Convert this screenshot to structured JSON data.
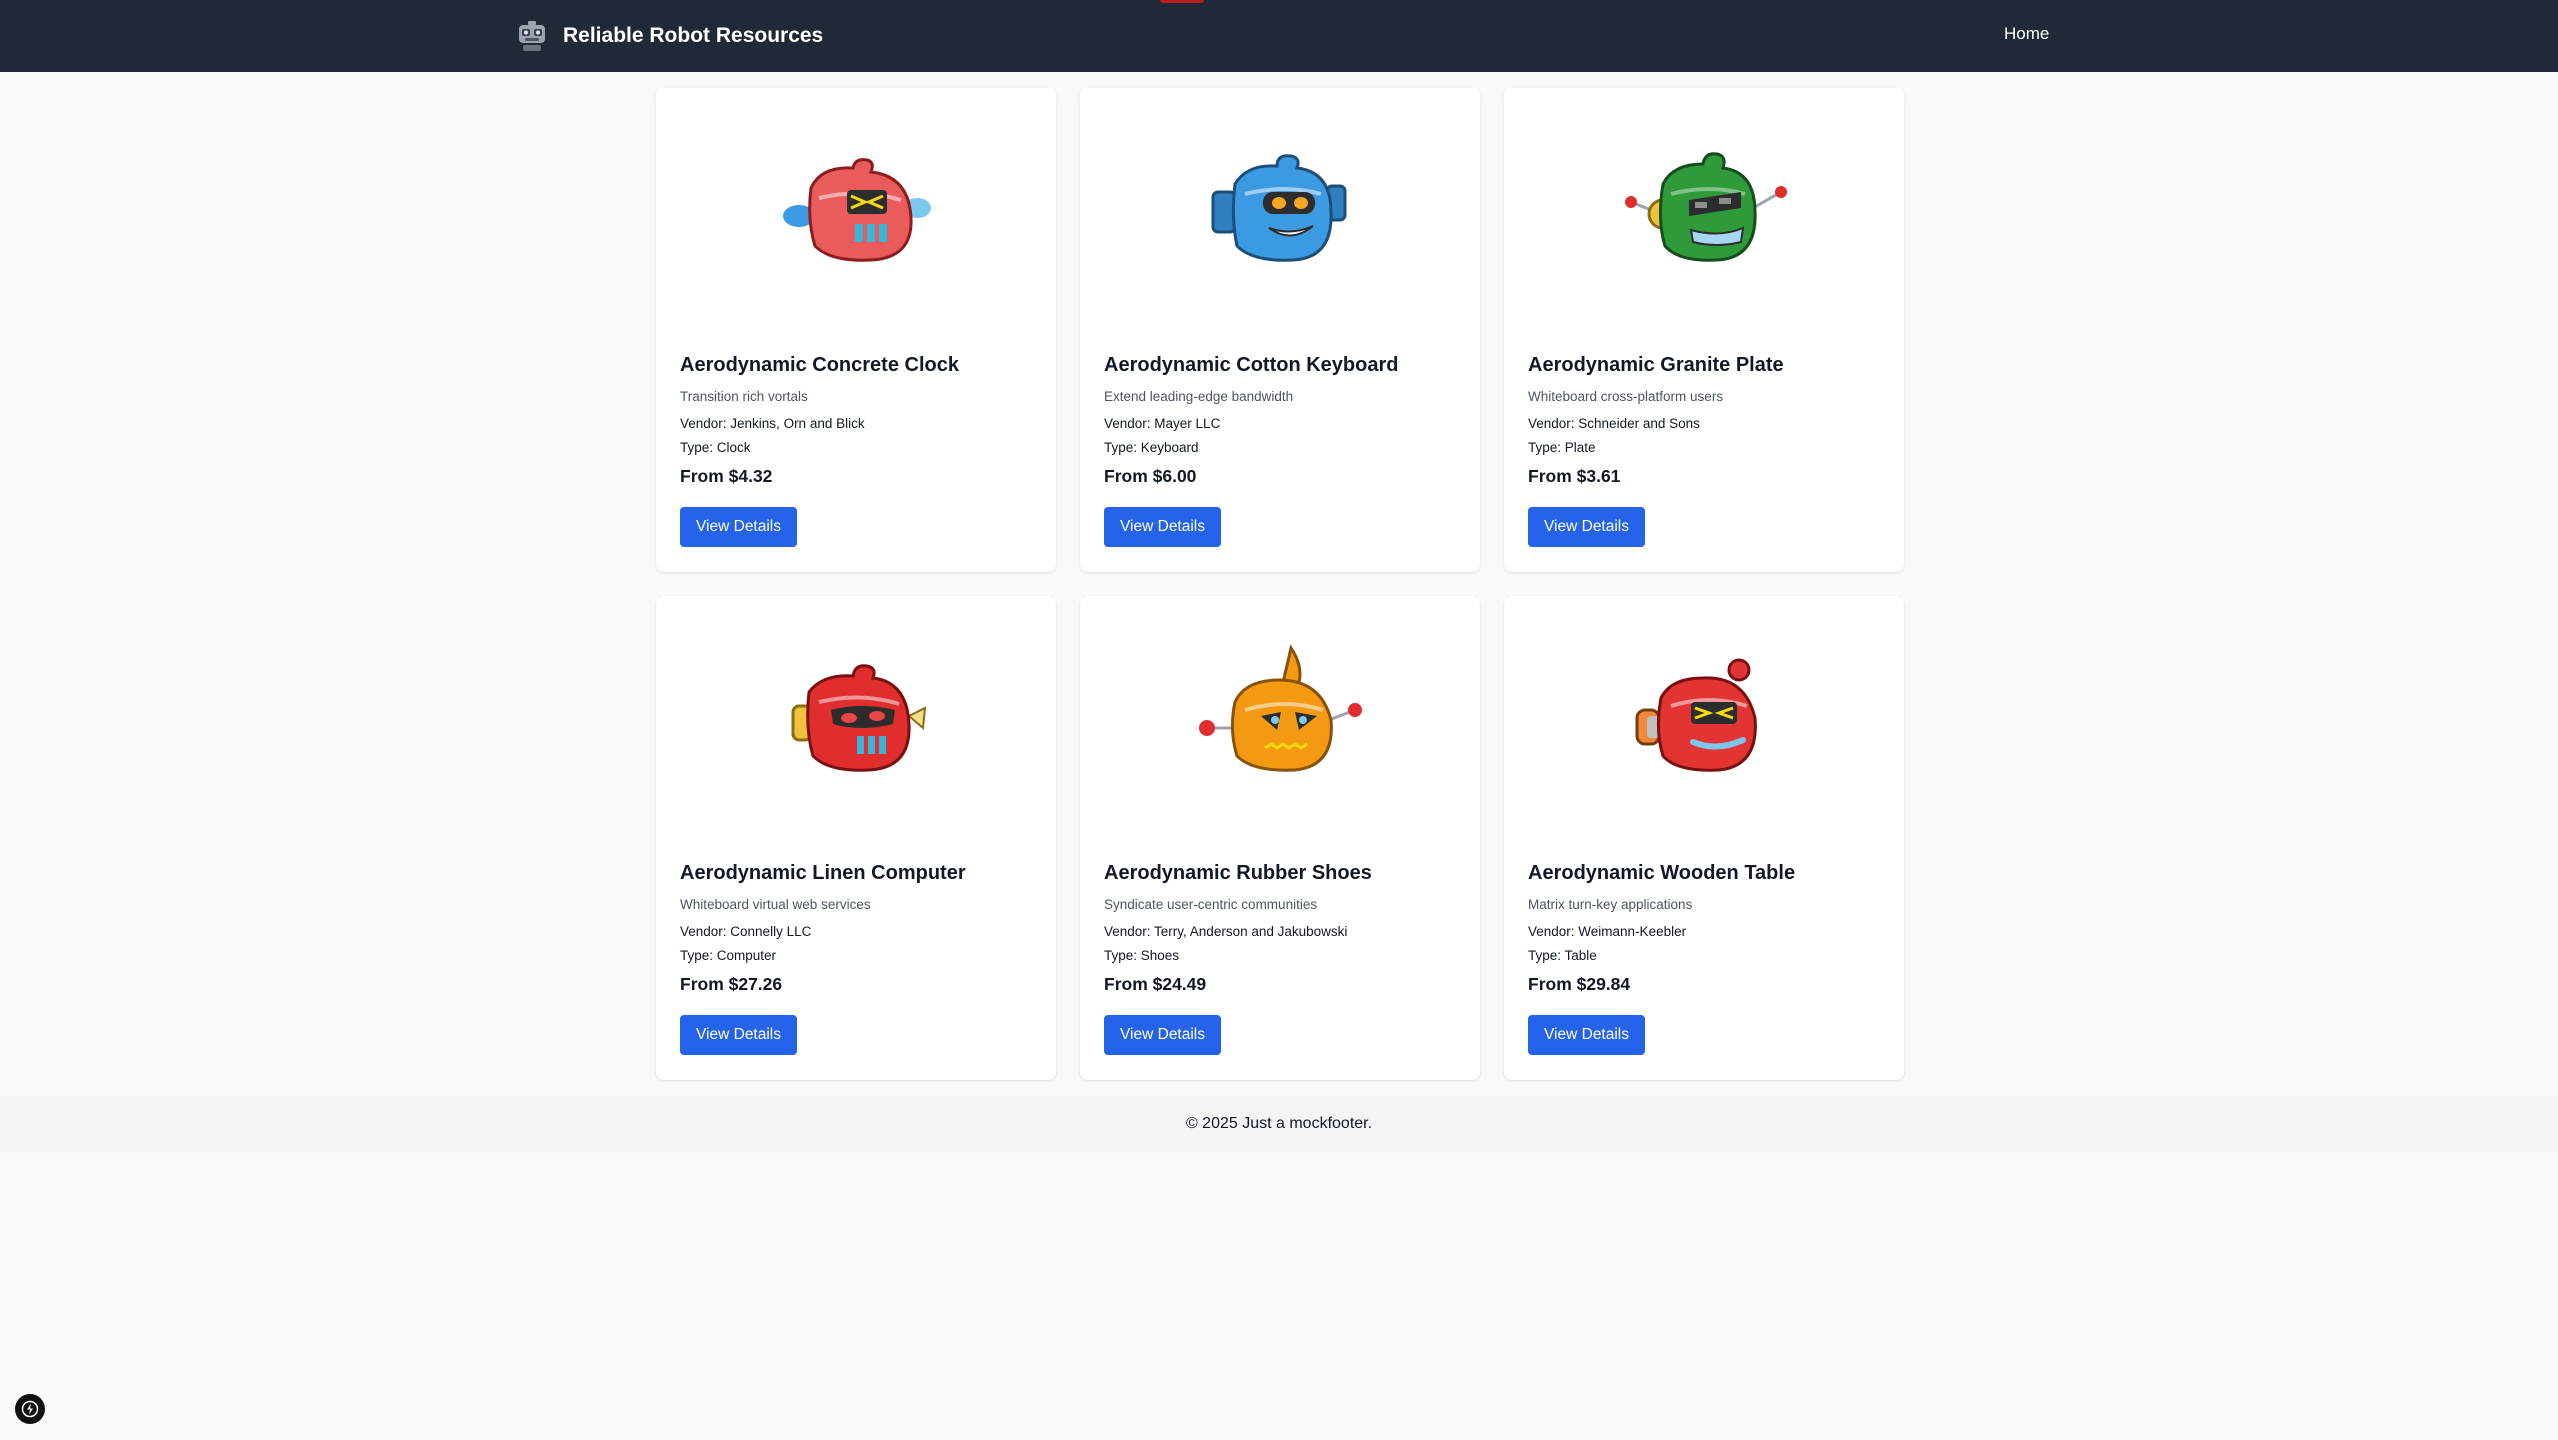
{
  "navbar": {
    "brand": "Reliable Robot Resources",
    "logo_icon": "robot-logo-icon",
    "home_link": "Home"
  },
  "products": [
    {
      "title": "Aerodynamic Concrete Clock",
      "description": "Transition rich vortals",
      "vendor": "Vendor: Jenkins, Orn and Blick",
      "type": "Type: Clock",
      "price": "From $4.32",
      "button": "View Details",
      "image_icon": "robot-head-red-icon",
      "color": "#ea5b5b"
    },
    {
      "title": "Aerodynamic Cotton Keyboard",
      "description": "Extend leading-edge bandwidth",
      "vendor": "Vendor: Mayer LLC",
      "type": "Type: Keyboard",
      "price": "From $6.00",
      "button": "View Details",
      "image_icon": "robot-head-blue-icon",
      "color": "#3b9ae1"
    },
    {
      "title": "Aerodynamic Granite Plate",
      "description": "Whiteboard cross-platform users",
      "vendor": "Vendor: Schneider and Sons",
      "type": "Type: Plate",
      "price": "From $3.61",
      "button": "View Details",
      "image_icon": "robot-head-green-icon",
      "color": "#2f9a3a"
    },
    {
      "title": "Aerodynamic Linen Computer",
      "description": "Whiteboard virtual web services",
      "vendor": "Vendor: Connelly LLC",
      "type": "Type: Computer",
      "price": "From $27.26",
      "button": "View Details",
      "image_icon": "robot-head-red-icon",
      "color": "#e02d2d"
    },
    {
      "title": "Aerodynamic Rubber Shoes",
      "description": "Syndicate user-centric communities",
      "vendor": "Vendor: Terry, Anderson and Jakubowski",
      "type": "Type: Shoes",
      "price": "From $24.49",
      "button": "View Details",
      "image_icon": "robot-head-orange-icon",
      "color": "#f39a12"
    },
    {
      "title": "Aerodynamic Wooden Table",
      "description": "Matrix turn-key applications",
      "vendor": "Vendor: Weimann-Keebler",
      "type": "Type: Table",
      "price": "From $29.84",
      "button": "View Details",
      "image_icon": "robot-head-red-icon",
      "color": "#e33434"
    }
  ],
  "footer": {
    "text": "© 2025 Just a mockfooter."
  },
  "floating_button": {
    "icon": "lightning-bolt-icon"
  }
}
